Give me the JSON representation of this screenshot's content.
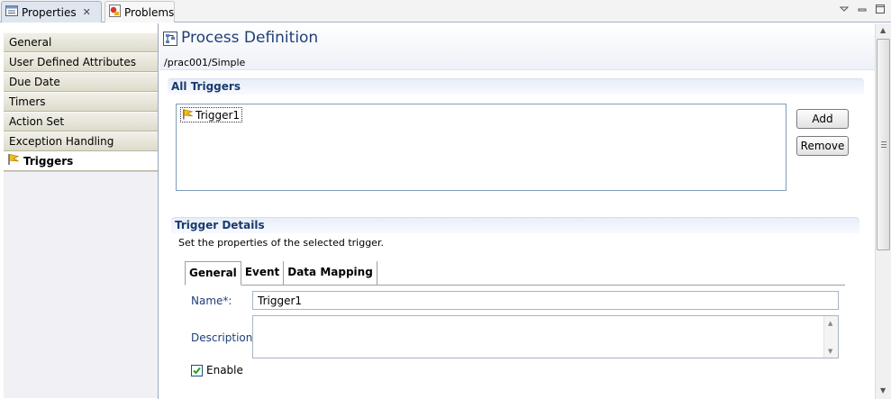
{
  "view_tabs": [
    {
      "label": "Properties",
      "icon": "properties-icon",
      "active": true,
      "closable": true
    },
    {
      "label": "Problems",
      "icon": "problems-icon",
      "active": false
    }
  ],
  "nav": {
    "items": [
      {
        "label": "General"
      },
      {
        "label": "User Defined Attributes"
      },
      {
        "label": "Due Date"
      },
      {
        "label": "Timers"
      },
      {
        "label": "Action Set"
      },
      {
        "label": "Exception Handling"
      },
      {
        "label": "Triggers",
        "icon": "trigger-flag-icon",
        "selected": true
      }
    ]
  },
  "header": {
    "title": "Process Definition",
    "path": "/prac001/Simple",
    "icon": "process-definition-icon"
  },
  "all_triggers": {
    "title": "All Triggers",
    "items": [
      {
        "label": "Trigger1",
        "icon": "trigger-flag-icon"
      }
    ],
    "add_label": "Add",
    "remove_label": "Remove"
  },
  "trigger_details": {
    "title": "Trigger Details",
    "description": "Set the properties of the selected trigger.",
    "tabs": [
      {
        "label": "General",
        "active": true
      },
      {
        "label": "Event"
      },
      {
        "label": "Data Mapping"
      }
    ],
    "name_label": "Name*:",
    "name_value": "Trigger1",
    "description_label": "Description:",
    "description_value": "",
    "enable_label": "Enable",
    "enable_checked": true
  },
  "colors": {
    "title_blue": "#1e3f78",
    "section_blue": "#1a3a6e",
    "nav_tab_bg": "#dedbcc"
  }
}
